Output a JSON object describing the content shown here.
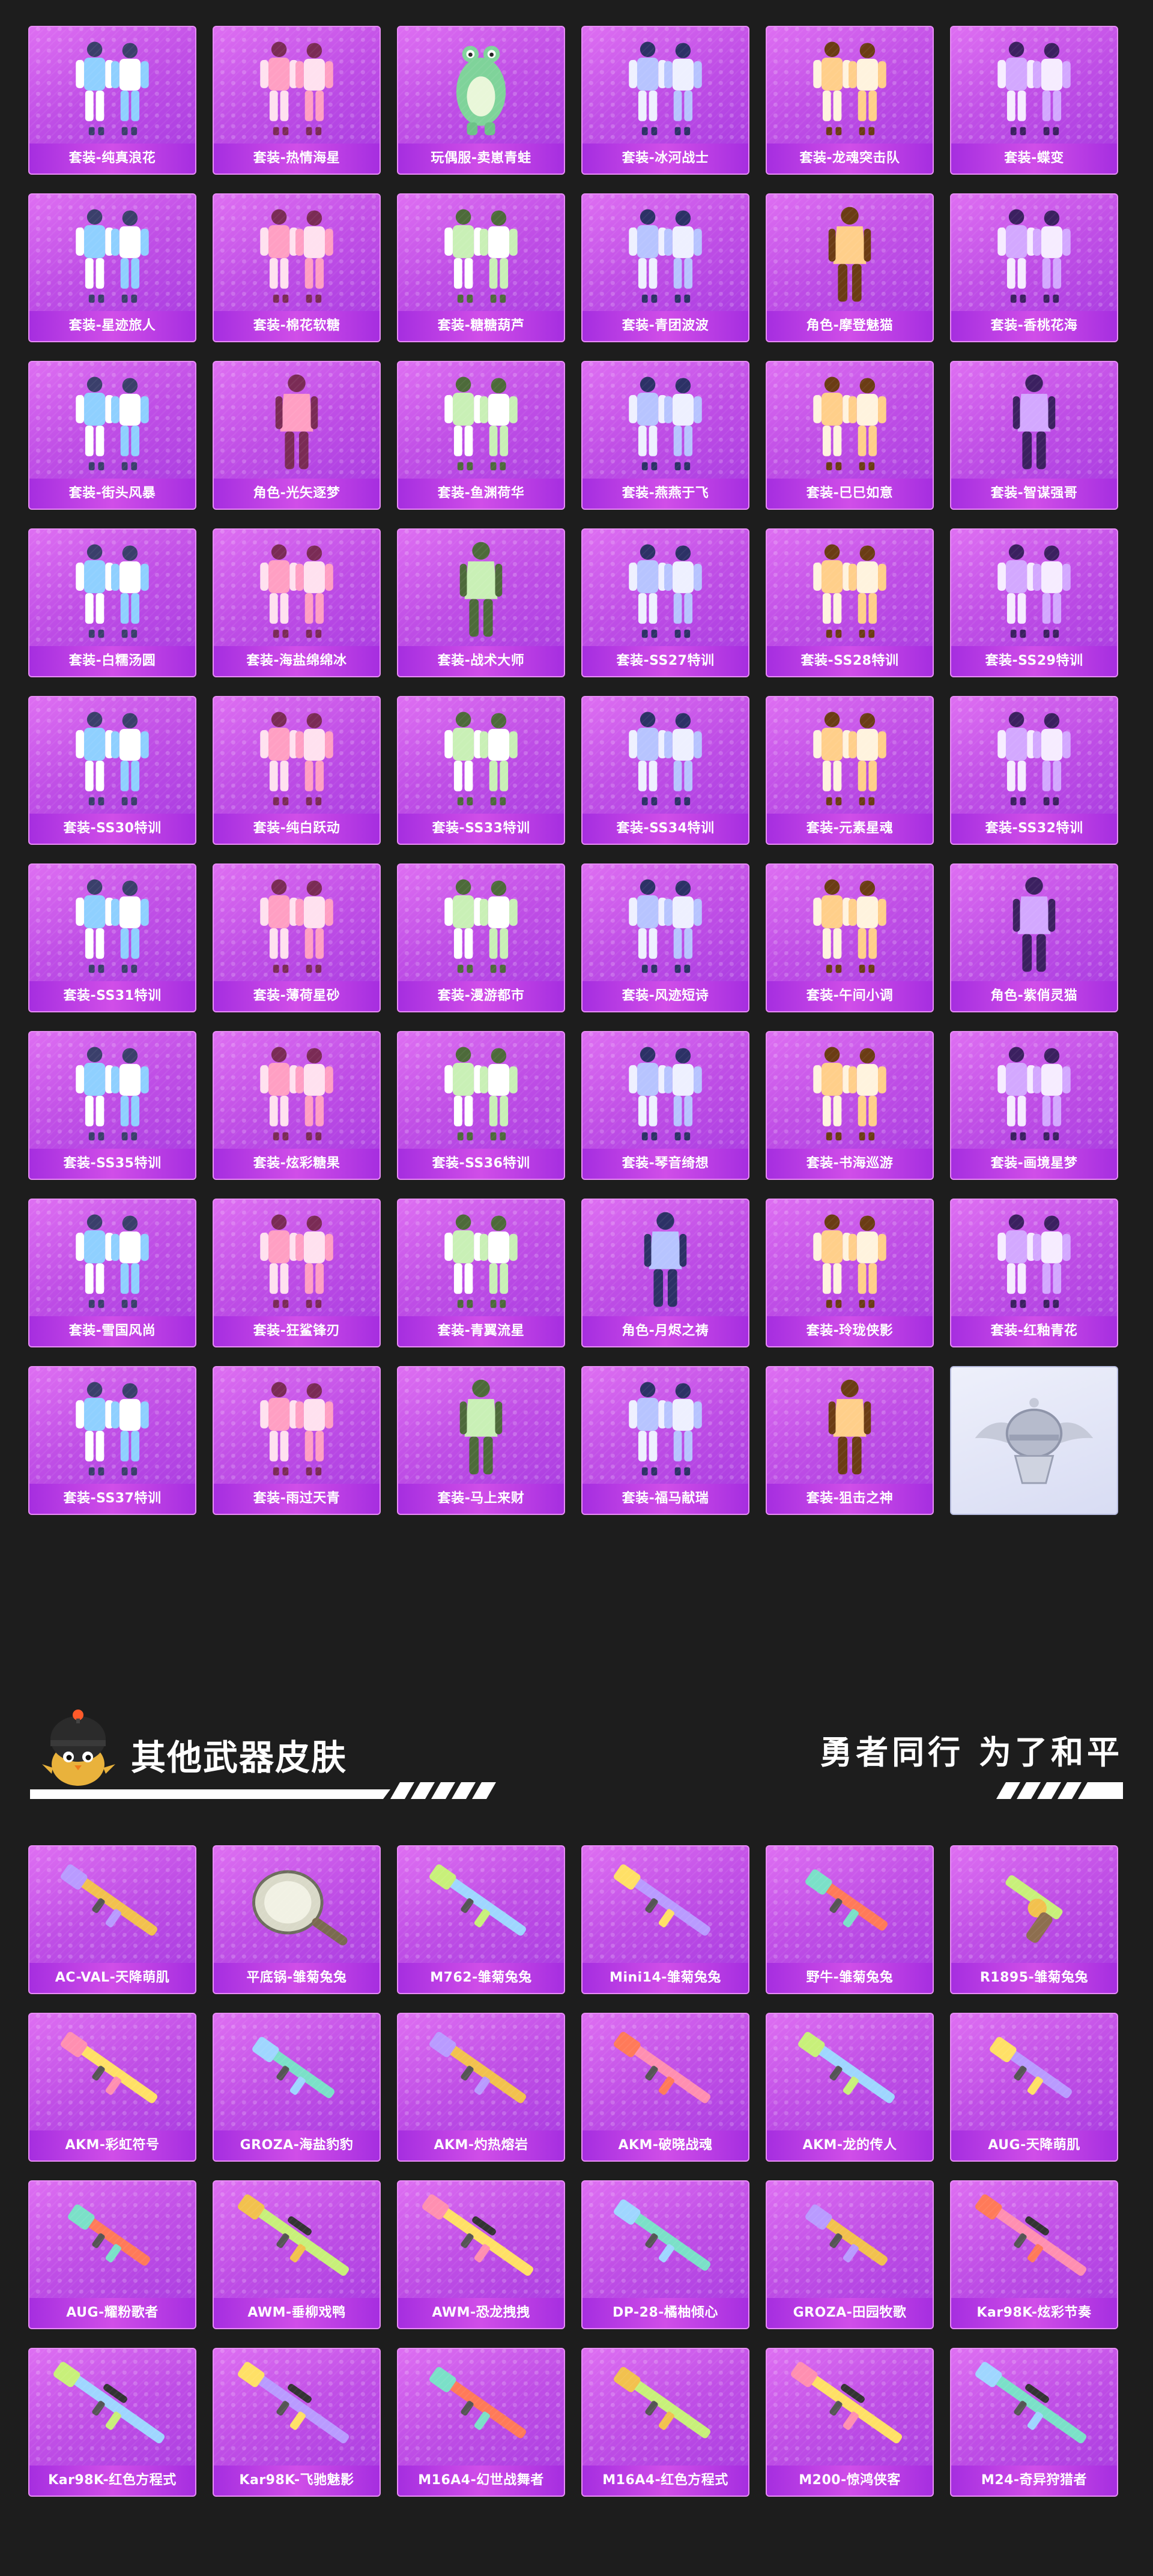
{
  "outfits": [
    {
      "label": "套装-纯真浪花",
      "art": "outfit"
    },
    {
      "label": "套装-热情海星",
      "art": "outfit"
    },
    {
      "label": "玩偶服-卖崽青蛙",
      "art": "mascot"
    },
    {
      "label": "套装-冰河战士",
      "art": "outfit"
    },
    {
      "label": "套装-龙魂突击队",
      "art": "outfit"
    },
    {
      "label": "套装-蝶变",
      "art": "outfit"
    },
    {
      "label": "套装-星迹旅人",
      "art": "outfit"
    },
    {
      "label": "套装-棉花软糖",
      "art": "outfit"
    },
    {
      "label": "套装-糖糖葫芦",
      "art": "outfit"
    },
    {
      "label": "套装-青团波波",
      "art": "outfit"
    },
    {
      "label": "角色-摩登魅猫",
      "art": "character"
    },
    {
      "label": "套装-香桃花海",
      "art": "outfit"
    },
    {
      "label": "套装-街头风暴",
      "art": "outfit"
    },
    {
      "label": "角色-光矢逐梦",
      "art": "character"
    },
    {
      "label": "套装-鱼渊荷华",
      "art": "outfit"
    },
    {
      "label": "套装-燕燕于飞",
      "art": "outfit"
    },
    {
      "label": "套装-巳巳如意",
      "art": "outfit"
    },
    {
      "label": "套装-智谋强哥",
      "art": "character"
    },
    {
      "label": "套装-白糯汤圆",
      "art": "outfit"
    },
    {
      "label": "套装-海盐绵绵冰",
      "art": "outfit"
    },
    {
      "label": "套装-战术大师",
      "art": "character"
    },
    {
      "label": "套装-SS27特训",
      "art": "outfit"
    },
    {
      "label": "套装-SS28特训",
      "art": "outfit"
    },
    {
      "label": "套装-SS29特训",
      "art": "outfit"
    },
    {
      "label": "套装-SS30特训",
      "art": "outfit"
    },
    {
      "label": "套装-纯白跃动",
      "art": "outfit"
    },
    {
      "label": "套装-SS33特训",
      "art": "outfit"
    },
    {
      "label": "套装-SS34特训",
      "art": "outfit"
    },
    {
      "label": "套装-元素星魂",
      "art": "outfit"
    },
    {
      "label": "套装-SS32特训",
      "art": "outfit"
    },
    {
      "label": "套装-SS31特训",
      "art": "outfit"
    },
    {
      "label": "套装-薄荷星砂",
      "art": "outfit"
    },
    {
      "label": "套装-漫游都市",
      "art": "outfit"
    },
    {
      "label": "套装-风迹短诗",
      "art": "outfit"
    },
    {
      "label": "套装-午间小调",
      "art": "outfit"
    },
    {
      "label": "角色-紫俏灵猫",
      "art": "character"
    },
    {
      "label": "套装-SS35特训",
      "art": "outfit"
    },
    {
      "label": "套装-炫彩糖果",
      "art": "outfit"
    },
    {
      "label": "套装-SS36特训",
      "art": "outfit"
    },
    {
      "label": "套装-琴音绮想",
      "art": "outfit"
    },
    {
      "label": "套装-书海巡游",
      "art": "outfit"
    },
    {
      "label": "套装-画境星梦",
      "art": "outfit"
    },
    {
      "label": "套装-雪国风尚",
      "art": "outfit"
    },
    {
      "label": "套装-狂鲨锋刃",
      "art": "outfit"
    },
    {
      "label": "套装-青翼流星",
      "art": "outfit"
    },
    {
      "label": "角色-月烬之祷",
      "art": "character"
    },
    {
      "label": "套装-玲珑侠影",
      "art": "outfit"
    },
    {
      "label": "套装-红釉青花",
      "art": "outfit"
    },
    {
      "label": "套装-SS37特训",
      "art": "outfit"
    },
    {
      "label": "套装-雨过天青",
      "art": "outfit"
    },
    {
      "label": "套装-马上来财",
      "art": "character"
    },
    {
      "label": "套装-福马献瑞",
      "art": "outfit"
    },
    {
      "label": "套装-狙击之神",
      "art": "character"
    }
  ],
  "placeholder_card": {
    "art": "pubg-helmet-emblem"
  },
  "section_header": {
    "title": "其他武器皮肤",
    "slogan": "勇者同行 为了和平",
    "mascot_icon": "helmet-chick-mascot-icon"
  },
  "weapons": [
    {
      "label": "AC-VAL-天降萌肌",
      "art": "rifle"
    },
    {
      "label": "平底锅-雏菊兔兔",
      "art": "pan"
    },
    {
      "label": "M762-雏菊兔兔",
      "art": "rifle"
    },
    {
      "label": "Mini14-雏菊兔兔",
      "art": "rifle"
    },
    {
      "label": "野牛-雏菊兔兔",
      "art": "smg"
    },
    {
      "label": "R1895-雏菊兔兔",
      "art": "pistol"
    },
    {
      "label": "AKM-彩虹符号",
      "art": "rifle"
    },
    {
      "label": "GROZA-海盐豹豹",
      "art": "smg"
    },
    {
      "label": "AKM-灼热熔岩",
      "art": "rifle"
    },
    {
      "label": "AKM-破晓战魂",
      "art": "rifle"
    },
    {
      "label": "AKM-龙的传人",
      "art": "rifle"
    },
    {
      "label": "AUG-天降萌肌",
      "art": "smg"
    },
    {
      "label": "AUG-耀粉歌者",
      "art": "smg"
    },
    {
      "label": "AWM-垂柳戏鸭",
      "art": "sniper"
    },
    {
      "label": "AWM-恐龙拽拽",
      "art": "sniper"
    },
    {
      "label": "DP-28-橘柚倾心",
      "art": "rifle"
    },
    {
      "label": "GROZA-田园牧歌",
      "art": "smg"
    },
    {
      "label": "Kar98K-炫彩节奏",
      "art": "sniper"
    },
    {
      "label": "Kar98K-红色方程式",
      "art": "sniper"
    },
    {
      "label": "Kar98K-飞驰魅影",
      "art": "sniper"
    },
    {
      "label": "M16A4-幻世战舞者",
      "art": "rifle"
    },
    {
      "label": "M16A4-红色方程式",
      "art": "rifle"
    },
    {
      "label": "M200-惊鸿侠客",
      "art": "sniper"
    },
    {
      "label": "M24-奇异狩猎者",
      "art": "sniper"
    }
  ],
  "colors": {
    "page_bg": "#1d1d1d",
    "card_purple": "#c04fe6",
    "label_bar": "#a62ee0",
    "placeholder_bg": "#e3e6f7",
    "text": "#ffffff"
  }
}
